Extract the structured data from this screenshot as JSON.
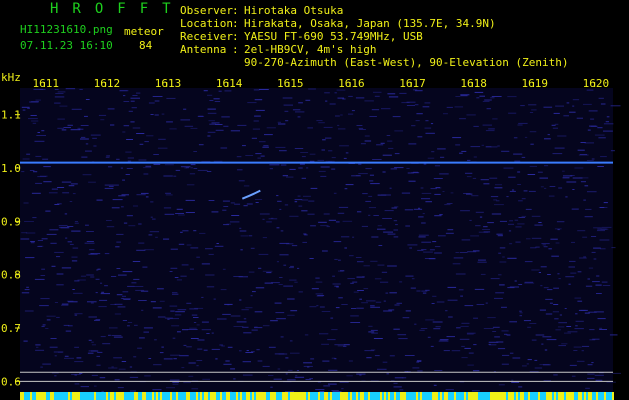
{
  "header": {
    "logo": "HROFFT",
    "filename": "HI11231610.png",
    "datetime": "07.11.23 16:10",
    "meteor_label": "meteor",
    "meteor_count": "84",
    "info": [
      {
        "key": "Observer",
        "value": "Hirotaka Otsuka"
      },
      {
        "key": "Location",
        "value": "Hirakata, Osaka, Japan (135.7E, 34.9N)"
      },
      {
        "key": "Receiver",
        "value": "YAESU FT-690 53.749MHz, USB"
      },
      {
        "key": "Antenna ",
        "value": "2el-HB9CV, 4m's high"
      },
      {
        "key": "",
        "value": "90-270-Azimuth (East-West), 90-Elevation (Zenith)"
      }
    ]
  },
  "chart_data": {
    "type": "heatmap",
    "title": "",
    "xlabel": "",
    "ylabel": "kHz",
    "x_ticks": [
      "1611",
      "1612",
      "1613",
      "1614",
      "1615",
      "1616",
      "1617",
      "1618",
      "1619",
      "1620"
    ],
    "y_ticks": [
      "1.1",
      "1.0",
      "0.9",
      "0.8",
      "0.7",
      "0.6"
    ],
    "y_tick_values": [
      1.1,
      1.0,
      0.9,
      0.8,
      0.7,
      0.6
    ],
    "xlim": [
      1610.6,
      1620.3
    ],
    "ylim": [
      0.58,
      1.15
    ],
    "carrier_khz": 1.01,
    "reference_lines_khz": [
      0.617,
      0.6
    ],
    "meteor_echo": {
      "time": 1614.4,
      "khz": 0.95
    },
    "colors": {
      "background": "#05051e",
      "carrier": "#3a7cff",
      "noise": "#2a2aa0",
      "ref_line": "#c8c8c8",
      "axis": "#f0f018",
      "header": "#1ed01e"
    }
  }
}
